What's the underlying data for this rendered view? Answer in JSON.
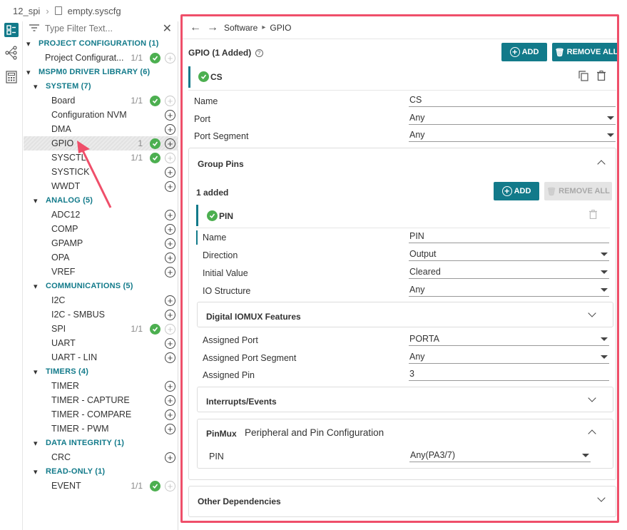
{
  "top": {
    "project": "12_spi",
    "file": "empty.syscfg"
  },
  "filter": {
    "placeholder": "Type Filter Text..."
  },
  "tree": [
    {
      "kind": "cat",
      "label": "PROJECT CONFIGURATION (1)",
      "indent": 0
    },
    {
      "kind": "item",
      "label": "Project Configurat...",
      "count": "1/1",
      "check": true,
      "plus": "dim"
    },
    {
      "kind": "cat",
      "label": "MSPM0 DRIVER LIBRARY (6)",
      "indent": 0
    },
    {
      "kind": "cat",
      "label": "SYSTEM (7)",
      "indent": 1
    },
    {
      "kind": "item",
      "label": "Board",
      "count": "1/1",
      "check": true,
      "plus": "dim"
    },
    {
      "kind": "item",
      "label": "Configuration NVM",
      "count": "",
      "check": false,
      "plus": "on"
    },
    {
      "kind": "item",
      "label": "DMA",
      "count": "",
      "check": false,
      "plus": "on"
    },
    {
      "kind": "item",
      "label": "GPIO",
      "count": "1",
      "check": true,
      "plus": "on",
      "selected": true
    },
    {
      "kind": "item",
      "label": "SYSCTL",
      "count": "1/1",
      "check": true,
      "plus": "dim"
    },
    {
      "kind": "item",
      "label": "SYSTICK",
      "count": "",
      "check": false,
      "plus": "on"
    },
    {
      "kind": "item",
      "label": "WWDT",
      "count": "",
      "check": false,
      "plus": "on"
    },
    {
      "kind": "cat",
      "label": "ANALOG (5)",
      "indent": 1
    },
    {
      "kind": "item",
      "label": "ADC12",
      "count": "",
      "check": false,
      "plus": "on"
    },
    {
      "kind": "item",
      "label": "COMP",
      "count": "",
      "check": false,
      "plus": "on"
    },
    {
      "kind": "item",
      "label": "GPAMP",
      "count": "",
      "check": false,
      "plus": "on"
    },
    {
      "kind": "item",
      "label": "OPA",
      "count": "",
      "check": false,
      "plus": "on"
    },
    {
      "kind": "item",
      "label": "VREF",
      "count": "",
      "check": false,
      "plus": "on"
    },
    {
      "kind": "cat",
      "label": "COMMUNICATIONS (5)",
      "indent": 1
    },
    {
      "kind": "item",
      "label": "I2C",
      "count": "",
      "check": false,
      "plus": "on"
    },
    {
      "kind": "item",
      "label": "I2C - SMBUS",
      "count": "",
      "check": false,
      "plus": "on"
    },
    {
      "kind": "item",
      "label": "SPI",
      "count": "1/1",
      "check": true,
      "plus": "dim"
    },
    {
      "kind": "item",
      "label": "UART",
      "count": "",
      "check": false,
      "plus": "on"
    },
    {
      "kind": "item",
      "label": "UART - LIN",
      "count": "",
      "check": false,
      "plus": "on"
    },
    {
      "kind": "cat",
      "label": "TIMERS (4)",
      "indent": 1
    },
    {
      "kind": "item",
      "label": "TIMER",
      "count": "",
      "check": false,
      "plus": "on"
    },
    {
      "kind": "item",
      "label": "TIMER - CAPTURE",
      "count": "",
      "check": false,
      "plus": "on"
    },
    {
      "kind": "item",
      "label": "TIMER - COMPARE",
      "count": "",
      "check": false,
      "plus": "on"
    },
    {
      "kind": "item",
      "label": "TIMER - PWM",
      "count": "",
      "check": false,
      "plus": "on"
    },
    {
      "kind": "cat",
      "label": "DATA INTEGRITY (1)",
      "indent": 1
    },
    {
      "kind": "item",
      "label": "CRC",
      "count": "",
      "check": false,
      "plus": "on"
    },
    {
      "kind": "cat",
      "label": "READ-ONLY (1)",
      "indent": 1
    },
    {
      "kind": "item",
      "label": "EVENT",
      "count": "1/1",
      "check": true,
      "plus": "dim"
    }
  ],
  "nav": {
    "crumb1": "Software",
    "crumb2": "GPIO"
  },
  "gpio": {
    "header": "GPIO (1 Added)",
    "add_label": "ADD",
    "remove_all_label": "REMOVE ALL",
    "instance_name": "CS",
    "fields": [
      {
        "label": "Name",
        "value": "CS",
        "dropdown": false
      },
      {
        "label": "Port",
        "value": "Any",
        "dropdown": true
      },
      {
        "label": "Port Segment",
        "value": "Any",
        "dropdown": true
      }
    ],
    "group_pins": {
      "title": "Group Pins",
      "added": "1 added",
      "add_label": "ADD",
      "remove_all_label": "REMOVE ALL",
      "pin_name": "PIN",
      "fields": [
        {
          "label": "Name",
          "value": "PIN",
          "dropdown": false
        },
        {
          "label": "Direction",
          "value": "Output",
          "dropdown": true
        },
        {
          "label": "Initial Value",
          "value": "Cleared",
          "dropdown": true
        },
        {
          "label": "IO Structure",
          "value": "Any",
          "dropdown": true
        }
      ],
      "iomux_title": "Digital IOMUX Features",
      "assign_fields": [
        {
          "label": "Assigned Port",
          "value": "PORTA",
          "dropdown": true
        },
        {
          "label": "Assigned Port Segment",
          "value": "Any",
          "dropdown": true
        },
        {
          "label": "Assigned Pin",
          "value": "3",
          "dropdown": false
        }
      ],
      "interrupts_title": "Interrupts/Events",
      "pinmux_title": "PinMux",
      "pinmux_subtitle": "Peripheral and Pin Configuration",
      "pinmux_field": {
        "label": "PIN",
        "value": "Any(PA3/7)"
      }
    },
    "other_deps_title": "Other Dependencies"
  },
  "colors": {
    "accent": "#127a8a",
    "check": "#4caf50",
    "highlight": "#ef4f6a"
  }
}
